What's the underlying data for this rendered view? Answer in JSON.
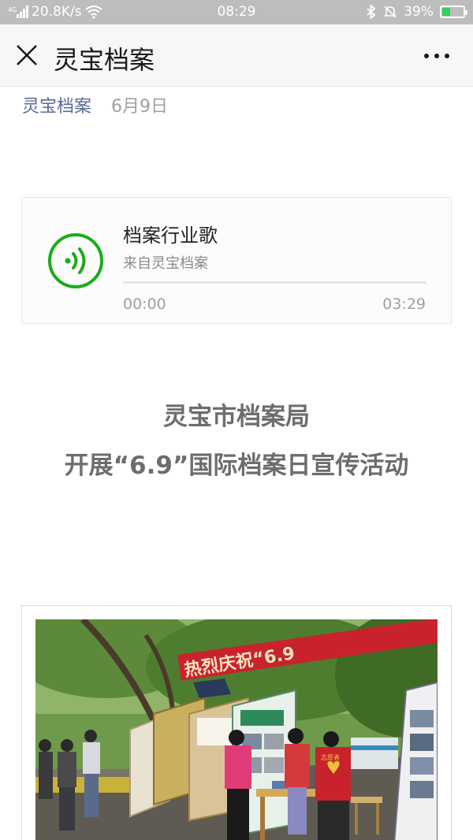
{
  "status_bar": {
    "network_speed": "20.8K/s",
    "time": "08:29",
    "battery": "39%",
    "battery_level": 0.39,
    "battery_color": "#2fd25a"
  },
  "nav": {
    "title": "灵宝档案"
  },
  "meta": {
    "account": "灵宝档案",
    "date": "6月9日",
    "account_color": "#576b95"
  },
  "audio": {
    "title": "档案行业歌",
    "source": "来自灵宝档案",
    "time_current": "00:00",
    "time_total": "03:29",
    "progress": 0,
    "accent_color": "#1aad19"
  },
  "article": {
    "heading_line1": "灵宝市档案局",
    "heading_line2": "开展“6.9”国际档案日宣传活动"
  },
  "photo": {
    "banner_text": "热烈庆祝“6.9",
    "vest_text": "志愿者"
  }
}
